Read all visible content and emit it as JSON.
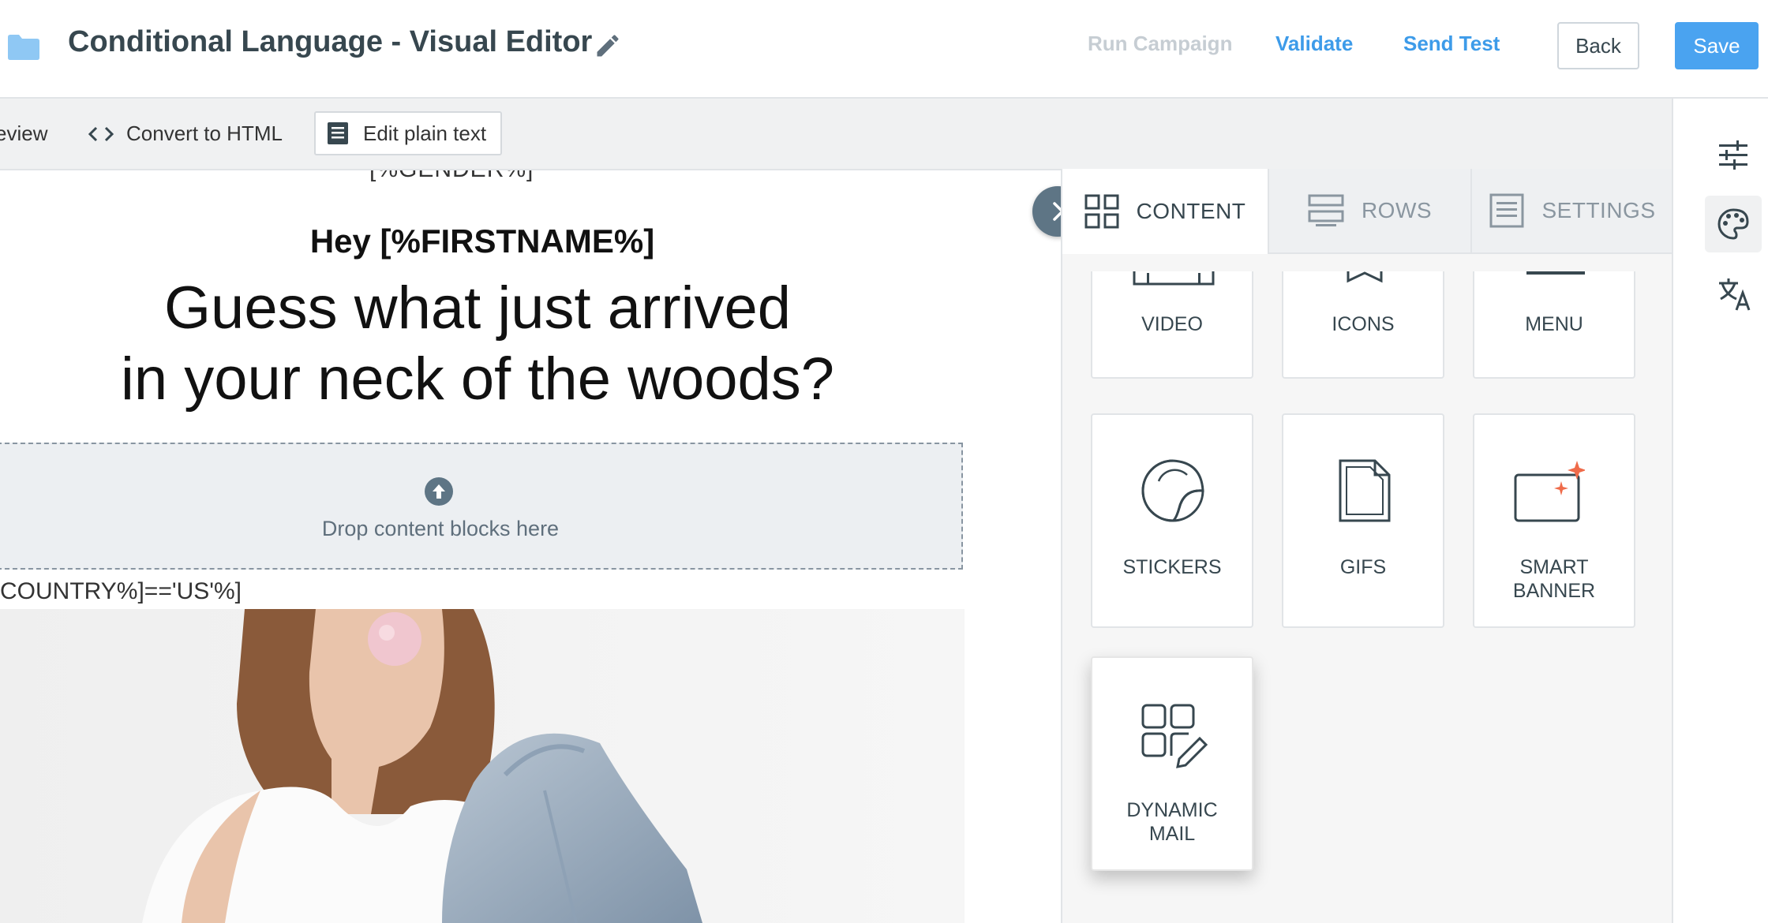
{
  "header": {
    "title": "Conditional Language - Visual Editor",
    "actions": {
      "run_campaign": "Run Campaign",
      "validate": "Validate",
      "send_test": "Send Test"
    },
    "back_label": "Back",
    "save_label": "Save",
    "colors": {
      "primary": "#4aa3f0",
      "link": "#3d9be9",
      "disabled": "#c6cdd3"
    }
  },
  "toolbar": {
    "preview_label": "eview",
    "convert_label": "Convert to HTML",
    "plain_text_label": "Edit plain text"
  },
  "canvas": {
    "greeting": "Hey [%FIRSTNAME%]",
    "headline_line1": "Guess what just arrived",
    "headline_line2": "in your neck of the woods?",
    "drop_text": "Drop content blocks here",
    "condition_text": "COUNTRY%]=='US'%]"
  },
  "panel": {
    "tabs": [
      {
        "label": "CONTENT",
        "icon": "grid-icon",
        "active": true
      },
      {
        "label": "ROWS",
        "icon": "rows-icon",
        "active": false
      },
      {
        "label": "SETTINGS",
        "icon": "settings-doc-icon",
        "active": false
      }
    ],
    "blocks": [
      {
        "label": "VIDEO",
        "icon": "video-icon"
      },
      {
        "label": "ICONS",
        "icon": "icons-icon"
      },
      {
        "label": "MENU",
        "icon": "menu-icon"
      },
      {
        "label": "STICKERS",
        "icon": "sticker-icon"
      },
      {
        "label": "GIFS",
        "icon": "gif-icon"
      },
      {
        "label_line1": "SMART",
        "label_line2": "BANNER",
        "icon": "smart-banner-icon"
      },
      {
        "label_line1": "DYNAMIC",
        "label_line2": "MAIL",
        "icon": "dynamic-mail-icon"
      }
    ]
  },
  "rail": {
    "items": [
      {
        "icon": "sliders-icon",
        "active": false
      },
      {
        "icon": "palette-icon",
        "active": true
      },
      {
        "icon": "translate-icon",
        "active": false
      }
    ]
  }
}
